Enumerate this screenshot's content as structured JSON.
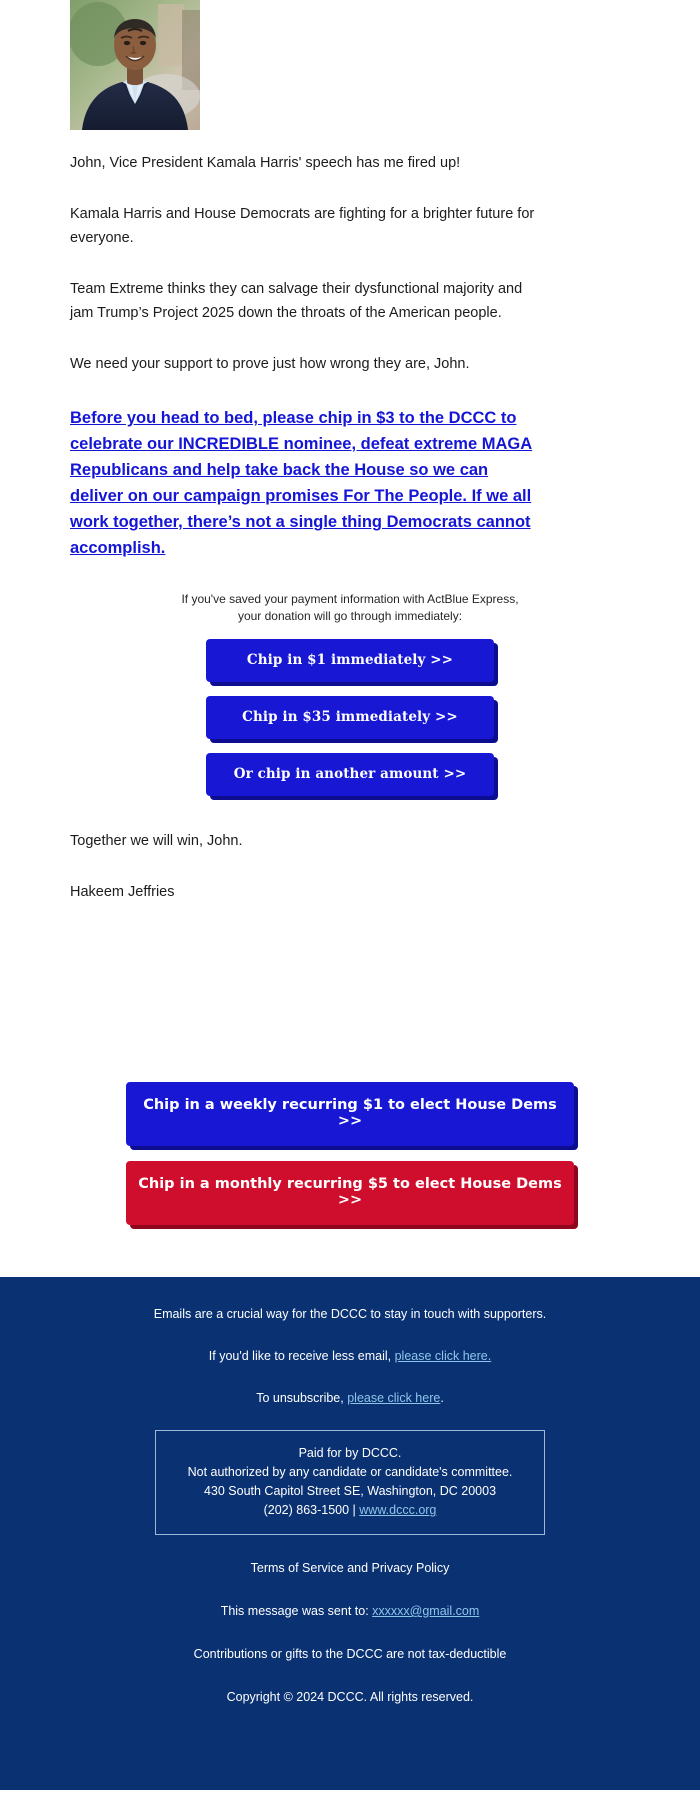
{
  "sender": {
    "portrait_alt": "Hakeem Jeffries portrait"
  },
  "body": {
    "paragraphs": [
      "John, Vice President Kamala Harris' speech has me fired up!",
      "Kamala Harris and House Democrats are fighting for a brighter future for everyone.",
      "Team Extreme thinks they can salvage their dysfunctional majority and jam Trump’s Project 2025 down the throats of the American people.",
      "We need your support to prove just how wrong they are, John."
    ],
    "ask_link": "Before you head to bed, please chip in $3 to the DCCC to celebrate our INCREDIBLE nominee, defeat extreme MAGA Republicans and help take back the House so we can deliver on our campaign promises For The People. If we all work together, there’s not a single thing Democrats cannot accomplish.",
    "closing": "Together we will win, John.",
    "signature": "Hakeem Jeffries"
  },
  "actblue": {
    "note_line1": "If you've saved your payment information with ActBlue Express,",
    "note_line2": "your donation will go through immediately:",
    "buttons": [
      {
        "label": "Chip in $1 immediately >>"
      },
      {
        "label": "Chip in $35 immediately >>"
      },
      {
        "label": "Or chip in another amount >>"
      }
    ]
  },
  "recurring": {
    "weekly_label": "Chip in a weekly recurring $1 to elect House Dems >>",
    "monthly_label": "Chip in a monthly recurring $5 to elect House Dems >>"
  },
  "footer": {
    "intro": "Emails are a crucial way for the DCCC to stay in touch with supporters.",
    "less_email_prefix": "If you'd like to receive less email, ",
    "less_email_link": "please click here.",
    "unsubscribe_prefix": "To unsubscribe, ",
    "unsubscribe_link": "please click here",
    "unsubscribe_suffix": ".",
    "disclaimer": {
      "line1": "Paid for by DCCC.",
      "line2": "Not authorized by any candidate or candidate's committee.",
      "line3": "430 South Capitol Street SE, Washington, DC 20003",
      "phone": "(202) 863-1500 | ",
      "website": "www.dccc.org"
    },
    "terms": "Terms of Service and Privacy Policy",
    "sent_to_prefix": "This message was sent to: ",
    "sent_to_email": "xxxxxx@gmail.com",
    "tax_note": "Contributions or gifts to the DCCC are not tax-deductible",
    "copyright": "Copyright © 2024 DCCC. All rights reserved."
  },
  "colors": {
    "link_blue": "#1515d6",
    "button_blue": "#1717d4",
    "button_blue_shadow": "#0d0d8f",
    "button_red": "#cf0e2d",
    "button_red_shadow": "#90071d",
    "footer_bg": "#0a3172",
    "footer_link": "#8fc5ea"
  }
}
